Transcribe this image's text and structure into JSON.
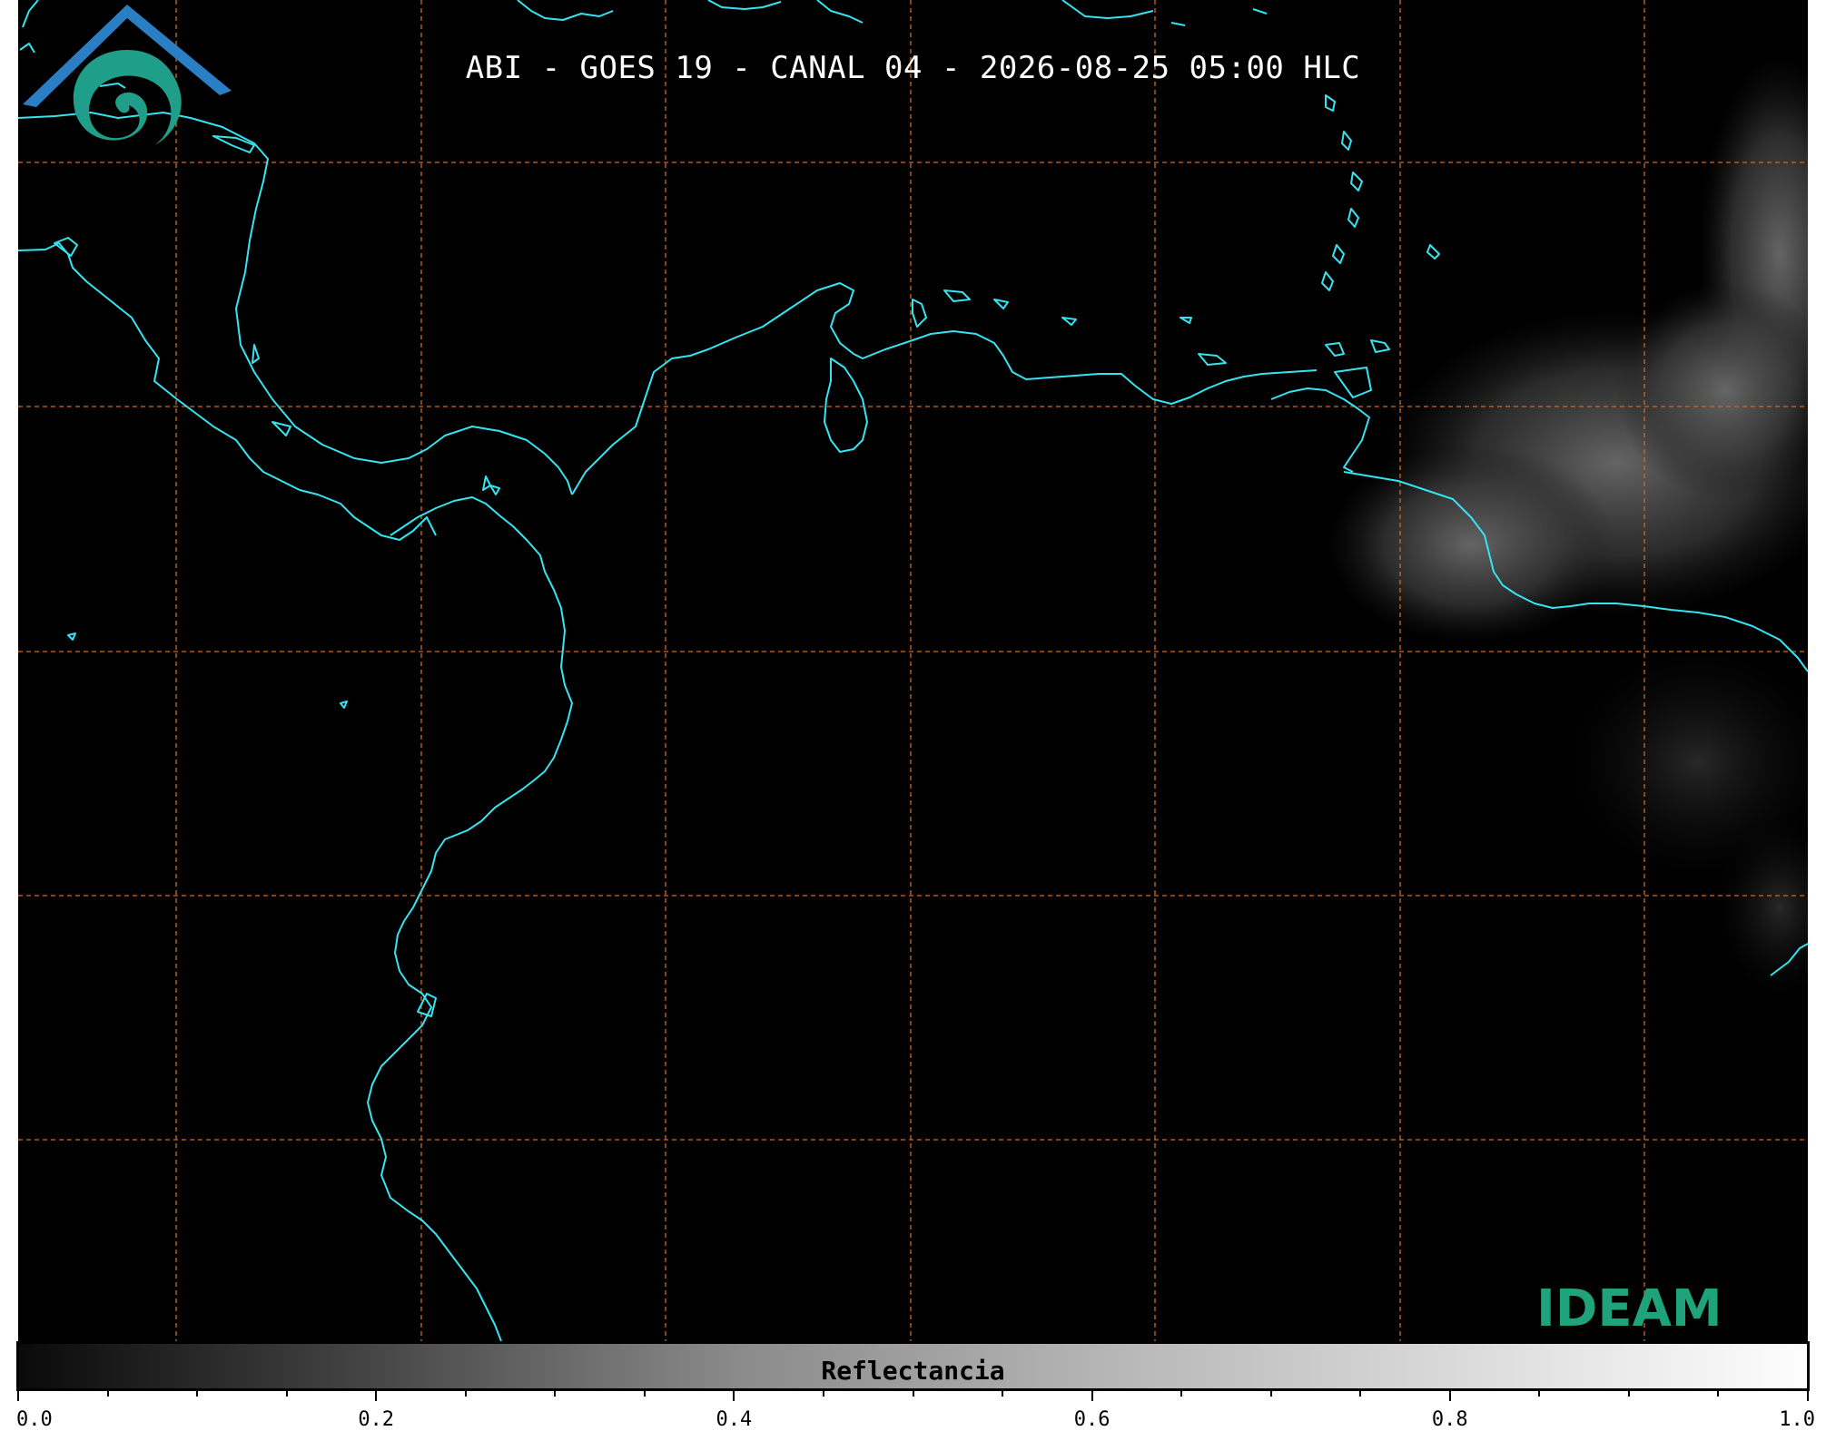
{
  "title": "ABI - GOES 19 - CANAL 04 - 2026-08-25 05:00 HLC",
  "colorbar": {
    "label": "Reflectancia",
    "ticks": [
      "0.0",
      "0.2",
      "0.4",
      "0.6",
      "0.8",
      "1.0"
    ],
    "range": [
      0.0,
      1.0
    ]
  },
  "logo": {
    "text": "IDEAM",
    "colors": {
      "top": "#2a7ec4",
      "bottom": "#20b07a"
    }
  },
  "map": {
    "background": "#000000",
    "coastline_color": "#35e4f0",
    "grid_color": "#d2691e",
    "grid_style": "dashed"
  }
}
